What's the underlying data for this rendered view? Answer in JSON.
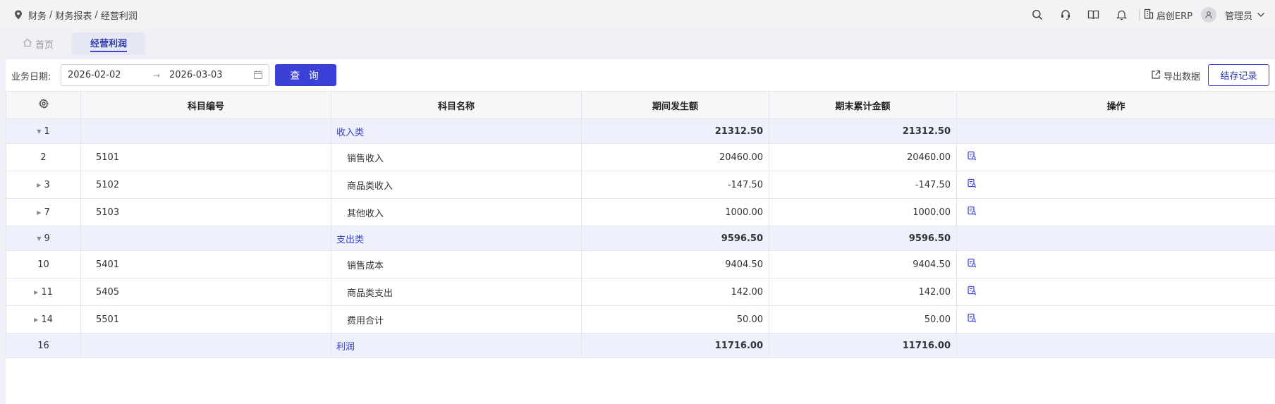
{
  "breadcrumb": {
    "items": [
      "财务",
      "财务报表",
      "经营利润"
    ],
    "separator": "/"
  },
  "header": {
    "company": "启创ERP",
    "user": "管理员"
  },
  "tabs": {
    "home": "首页",
    "active": "经营利润"
  },
  "filter": {
    "label": "业务日期:",
    "start_date": "2026-02-02",
    "arrow": "→",
    "end_date": "2026-03-03",
    "query_label": "查 询",
    "export_label": "导出数据",
    "save_label": "结存记录"
  },
  "table": {
    "columns": [
      "",
      "科目编号",
      "科目名称",
      "期间发生额",
      "期末累计金额",
      "操作"
    ],
    "rows": [
      {
        "type": "group",
        "caret": "down",
        "seq": "1",
        "code": "",
        "name": "收入类",
        "period": "21312.50",
        "total": "21312.50"
      },
      {
        "type": "item",
        "caret": "",
        "seq": "2",
        "code": "5101",
        "name": "销售收入",
        "period": "20460.00",
        "total": "20460.00"
      },
      {
        "type": "item",
        "caret": "right",
        "seq": "3",
        "code": "5102",
        "name": "商品类收入",
        "period": "-147.50",
        "total": "-147.50"
      },
      {
        "type": "item",
        "caret": "right",
        "seq": "7",
        "code": "5103",
        "name": "其他收入",
        "period": "1000.00",
        "total": "1000.00"
      },
      {
        "type": "group",
        "caret": "down",
        "seq": "9",
        "code": "",
        "name": "支出类",
        "period": "9596.50",
        "total": "9596.50"
      },
      {
        "type": "item",
        "caret": "",
        "seq": "10",
        "code": "5401",
        "name": "销售成本",
        "period": "9404.50",
        "total": "9404.50"
      },
      {
        "type": "item",
        "caret": "right",
        "seq": "11",
        "code": "5405",
        "name": "商品类支出",
        "period": "142.00",
        "total": "142.00"
      },
      {
        "type": "item",
        "caret": "right",
        "seq": "14",
        "code": "5501",
        "name": "费用合计",
        "period": "50.00",
        "total": "50.00"
      },
      {
        "type": "group",
        "caret": "",
        "seq": "16",
        "code": "",
        "name": "利润",
        "period": "11716.00",
        "total": "11716.00"
      }
    ]
  },
  "colors": {
    "accent": "#3b40d6",
    "group_bg": "#eef0fb",
    "group_text": "#3440c0"
  },
  "icons": [
    "location-pin-icon",
    "search-icon",
    "support-icon",
    "book-icon",
    "bell-icon",
    "building-icon",
    "user-avatar-icon",
    "chevron-down-icon",
    "home-icon",
    "calendar-icon",
    "export-icon",
    "gear-icon",
    "view-detail-icon"
  ]
}
